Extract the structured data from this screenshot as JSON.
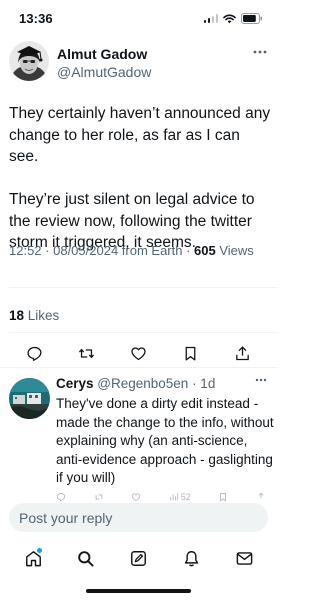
{
  "status_bar": {
    "time": "13:36",
    "battery_level": 0.85
  },
  "post": {
    "author_name": "Almut Gadow",
    "author_handle": "@AlmutGadow",
    "paragraphs": [
      "They certainly haven’t announced any change to her role, as far as I can see.",
      "They’re just silent on legal advice to the review now, following the twitter storm it triggered, it seems."
    ],
    "meta": {
      "time": "12:52",
      "separator": " · ",
      "date": "08/05/2024",
      "source": " from Earth",
      "views_count": "605",
      "views_label": " Views"
    },
    "likes": {
      "count": "18",
      "label": " Likes"
    },
    "actions": [
      "reply-icon",
      "repost-icon",
      "like-icon",
      "bookmark-icon",
      "share-icon"
    ]
  },
  "reply": {
    "author_name": "Cerys",
    "author_handle": " @Regenbo5en",
    "time": " · 1d",
    "text": "They've done a dirty edit instead - made the change to the info, without explaining why (an anti-science, anti-evidence approach - gaslighting if you will)",
    "views": "52"
  },
  "composer": {
    "placeholder": "Post your reply"
  },
  "tab_bar": {
    "tabs": [
      "home-icon",
      "search-icon",
      "communities-icon",
      "notifications-icon",
      "messages-icon"
    ]
  },
  "colors": {
    "text": "#0f1419",
    "secondary": "#536471",
    "accent": "#1d9bf0",
    "divider": "#eff3f4"
  }
}
